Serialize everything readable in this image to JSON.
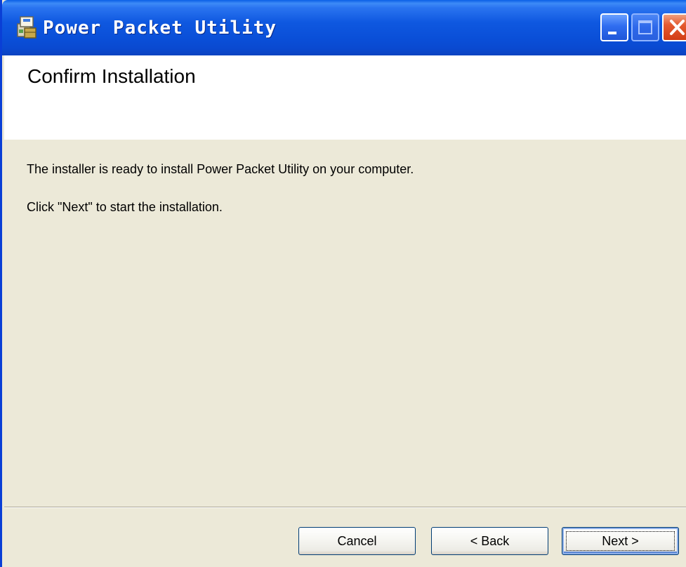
{
  "window": {
    "title": "Power Packet Utility",
    "icon": "installer-package-icon",
    "controls": {
      "minimize": "minimize-icon",
      "maximize": "maximize-icon",
      "close": "close-icon"
    }
  },
  "header": {
    "title": "Confirm Installation"
  },
  "body": {
    "line1": "The installer is ready to install Power Packet Utility  on your computer.",
    "line2": "Click \"Next\" to start the installation."
  },
  "buttons": {
    "cancel": "Cancel",
    "back": "< Back",
    "next": "Next >"
  },
  "colors": {
    "titlebar": "#0a4fd8",
    "close_button": "#d23d15",
    "dialog_background": "#ece9d8",
    "header_background": "#ffffff"
  }
}
